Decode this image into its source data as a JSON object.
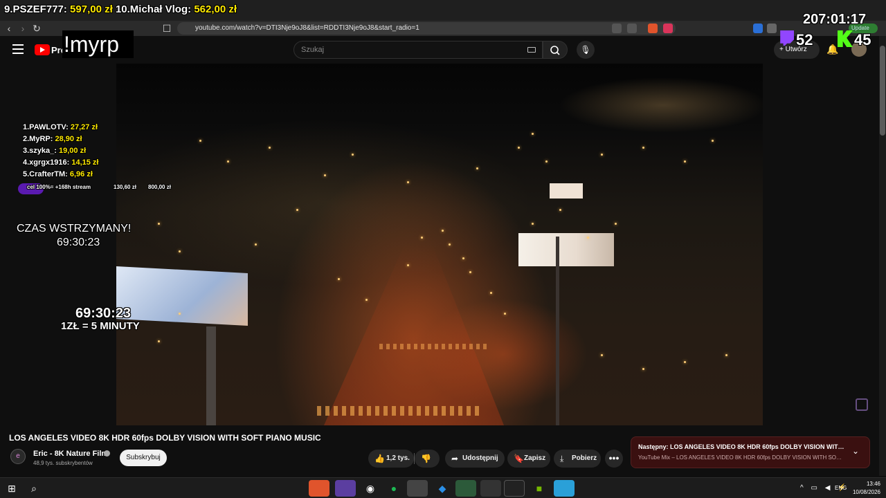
{
  "browser": {
    "url": "youtube.com/watch?v=DTI3Nje9oJ8&list=RDDTI3Nje9oJ8&start_radio=1",
    "update_label": "Update"
  },
  "youtube": {
    "brand": "Prei",
    "search_placeholder": "Szukaj",
    "create_label": "Utwórz"
  },
  "overlay": {
    "top_donors_line": "9.PSZEF777: 597,00 zł  10.Michał Vlog: 562,00 zł",
    "top_donor_9_name": "9.PSZEF777:",
    "top_donor_9_amount": "597,00 zł",
    "top_donor_10_name": "10.Michał Vlog:",
    "top_donor_10_amount": "562,00 zł",
    "timer_top": "207:01:17",
    "command": "!myrp",
    "ranking": [
      {
        "name": "1.PAWLOTV:",
        "amount": "27,27 zł"
      },
      {
        "name": "2.MyRP:",
        "amount": "28,90 zł"
      },
      {
        "name": "3.szyka_:",
        "amount": "19,00 zł"
      },
      {
        "name": "4.xgrgx1916:",
        "amount": "14,15 zł"
      },
      {
        "name": "5.CrafterTM:",
        "amount": "6,96 zł"
      }
    ],
    "goal_label": "cel 100%= +168h stream",
    "goal_current": "130,60 zł",
    "goal_max": "800,00 zł",
    "goal_progress": 0.163,
    "paused_label": "CZAS WSTRZYMANY!",
    "paused_time": "69:30:23",
    "sub_time": "69:30:23",
    "sub_rate": "1ZŁ = 5 MINUTY",
    "twitch_viewers": "52",
    "kick_viewers": "45"
  },
  "video": {
    "title": "LOS ANGELES VIDEO 8K HDR 60fps DOLBY VISION WITH SOFT PIANO MUSIC",
    "channel": "Eric - 8K Nature Film",
    "subscribers": "48,9 tys. subskrybentów",
    "subscribe_label": "Subskrybuj",
    "likes": "1,2 tys.",
    "share_label": "Udostępnij",
    "save_label": "Zapisz",
    "download_label": "Pobierz",
    "more_label": "•••"
  },
  "next": {
    "title": "Następny: LOS ANGELES VIDEO 8K HDR 60fps DOLBY VISION WITH S...",
    "subtitle": "YouTube Mix – LOS ANGELES VIDEO 8K HDR 60fps DOLBY VISION WITH SOFT PI..."
  },
  "taskbar": {
    "lang": "ENG",
    "time": "13:46",
    "date": "10/08/2026"
  },
  "colors": {
    "donor_amount": "#ffea00",
    "twitch": "#9146ff",
    "kick": "#53fc18",
    "youtube_red": "#ff0000"
  }
}
